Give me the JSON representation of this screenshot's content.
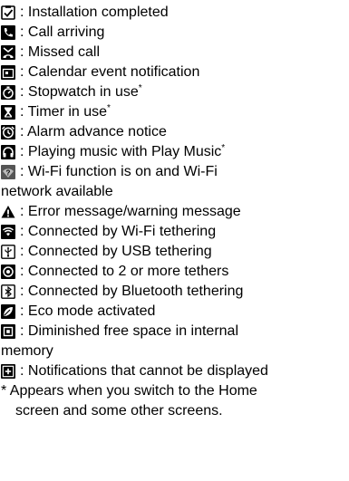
{
  "items": [
    {
      "icon": "installation-completed-icon",
      "text": ": Installation completed",
      "mark": ""
    },
    {
      "icon": "call-arriving-icon",
      "text": ": Call arriving",
      "mark": ""
    },
    {
      "icon": "missed-call-icon",
      "text": ": Missed call",
      "mark": ""
    },
    {
      "icon": "calendar-event-icon",
      "text": ": Calendar event notification",
      "mark": ""
    },
    {
      "icon": "stopwatch-icon",
      "text": ": Stopwatch in use",
      "mark": "*"
    },
    {
      "icon": "timer-icon",
      "text": ": Timer in use",
      "mark": "*"
    },
    {
      "icon": "alarm-icon",
      "text": ": Alarm advance notice",
      "mark": ""
    },
    {
      "icon": "headphones-icon",
      "text": ": Playing music with Play Music",
      "mark": "*"
    },
    {
      "icon": "wifi-available-icon",
      "text": ": Wi-Fi function is on and Wi-Fi",
      "mark": "",
      "continuation": "network available"
    },
    {
      "icon": "warning-icon",
      "text": ": Error message/warning message",
      "mark": ""
    },
    {
      "icon": "wifi-tethering-icon",
      "text": ": Connected by Wi-Fi tethering",
      "mark": ""
    },
    {
      "icon": "usb-tethering-icon",
      "text": ": Connected by USB tethering",
      "mark": ""
    },
    {
      "icon": "multi-tether-icon",
      "text": ": Connected to 2 or more tethers",
      "mark": ""
    },
    {
      "icon": "bluetooth-tethering-icon",
      "text": ": Connected by Bluetooth tethering",
      "mark": ""
    },
    {
      "icon": "eco-mode-icon",
      "text": ": Eco mode activated",
      "mark": ""
    },
    {
      "icon": "low-memory-icon",
      "text": ": Diminished free space in internal",
      "mark": "",
      "continuation": "memory"
    },
    {
      "icon": "more-notifications-icon",
      "text": ": Notifications that cannot be displayed",
      "mark": ""
    }
  ],
  "footnote": {
    "line1": "* Appears when you switch to the Home",
    "line2": "screen and some other screens."
  }
}
